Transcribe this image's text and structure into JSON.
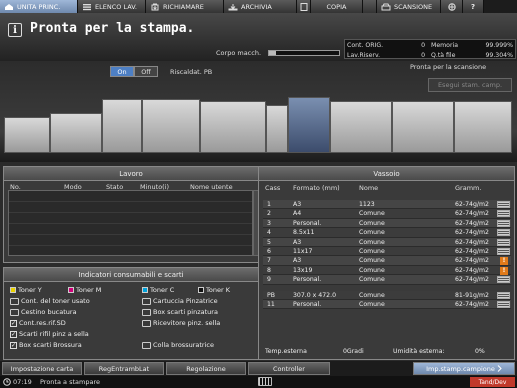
{
  "tabs": [
    {
      "label": "UNITA PRINC.",
      "icon": "home-icon",
      "active": true
    },
    {
      "label": "ELENCO LAV.",
      "icon": "job-list-icon",
      "active": false
    },
    {
      "label": "RICHIAMARE",
      "icon": "recall-icon",
      "active": false
    },
    {
      "label": "ARCHIVIA",
      "icon": "store-icon",
      "active": false
    },
    {
      "label": "COPIA",
      "icon": "copy-icon",
      "active": false
    },
    {
      "label": "SCANSIONE",
      "icon": "scan-icon",
      "active": false
    }
  ],
  "status": {
    "message": "Pronta per la stampa.",
    "corpo_label": "Corpo macch.",
    "corpo_level_fraction": 0.1
  },
  "counters": {
    "cont_orig_label": "Cont. ORIG.",
    "cont_orig_value": "0",
    "memoria_label": "Memoria",
    "memoria_value": "99.999%",
    "lav_riserv_label": "Lav.Riserv.",
    "lav_riserv_value": "0",
    "qta_file_label": "Q.tà file",
    "qta_file_value": "99.304%"
  },
  "machine": {
    "on_label": "On",
    "off_label": "Off",
    "heating_label": "Riscaldat. PB",
    "scan_status": "Pronta per la scansione",
    "sample_button": "Esegui stam. camp."
  },
  "lavoro": {
    "title": "Lavoro",
    "columns": [
      "No.",
      "Modo",
      "Stato",
      "Minuto(i)",
      "Nome utente"
    ]
  },
  "consumabili": {
    "title": "Indicatori consumabili e scarti",
    "items": [
      {
        "label": "Toner Y",
        "color": "#e8d000"
      },
      {
        "label": "Toner M",
        "color": "#d0007a"
      },
      {
        "label": "Toner C",
        "color": "#00a0d8"
      },
      {
        "label": "Toner K",
        "color": "#111111"
      },
      {
        "label": "Cont. del toner usato"
      },
      {
        "label": "Cartuccia Pinzatrice"
      },
      {
        "label": "Cestino bucatura"
      },
      {
        "label": "Box scarti pinzatura"
      },
      {
        "label": "Cont.res.rif.SD"
      },
      {
        "label": "Ricevitore pinz. sella"
      },
      {
        "label": "Scarti rifil pinz a sella"
      },
      {
        "label": "Box scarti Brossura"
      },
      {
        "label": "Colla brossuratrice"
      }
    ]
  },
  "vassoio": {
    "title": "Vassoio",
    "columns": [
      "Cass",
      "Formato (mm)",
      "Nome",
      "Gramm."
    ],
    "rows": [
      {
        "cass": "1",
        "formato": "A3",
        "nome": "1123",
        "gramm": "62-74g/m2",
        "warn": false
      },
      {
        "cass": "2",
        "formato": "A4",
        "nome": "Comune",
        "gramm": "62-74g/m2",
        "warn": false
      },
      {
        "cass": "3",
        "formato": "Personal.",
        "nome": "Comune",
        "gramm": "62-74g/m2",
        "warn": false
      },
      {
        "cass": "4",
        "formato": "8.5x11",
        "nome": "Comune",
        "gramm": "62-74g/m2",
        "warn": false
      },
      {
        "cass": "5",
        "formato": "A3",
        "nome": "Comune",
        "gramm": "62-74g/m2",
        "warn": false
      },
      {
        "cass": "6",
        "formato": "11x17",
        "nome": "Comune",
        "gramm": "62-74g/m2",
        "warn": false
      },
      {
        "cass": "7",
        "formato": "A3",
        "nome": "Comune",
        "gramm": "62-74g/m2",
        "warn": true
      },
      {
        "cass": "8",
        "formato": "13x19",
        "nome": "Comune",
        "gramm": "62-74g/m2",
        "warn": true
      },
      {
        "cass": "9",
        "formato": "Personal.",
        "nome": "Comune",
        "gramm": "62-74g/m2",
        "warn": false
      },
      {
        "cass": "PB",
        "formato": "307.0 x 472.0",
        "nome": "Comune",
        "gramm": "81-91g/m2",
        "warn": false
      },
      {
        "cass": "11",
        "formato": "Personal.",
        "nome": "Comune",
        "gramm": "62-74g/m2",
        "warn": false
      }
    ],
    "temp_label": "Temp.esterna",
    "temp_value": "0Gradi",
    "umidita_label": "Umidità esterna:",
    "umidita_value": "0%"
  },
  "buttons": {
    "impostazione": "Impostazione carta",
    "regentramb": "RegEntrambLat",
    "regolazione": "Regolazione",
    "controller": "Controller",
    "imp_stamp": "Imp.stamp.campione"
  },
  "statusbar": {
    "time": "07:19",
    "message": "Pronta a stampare",
    "tandev": "Tand/Dev"
  }
}
